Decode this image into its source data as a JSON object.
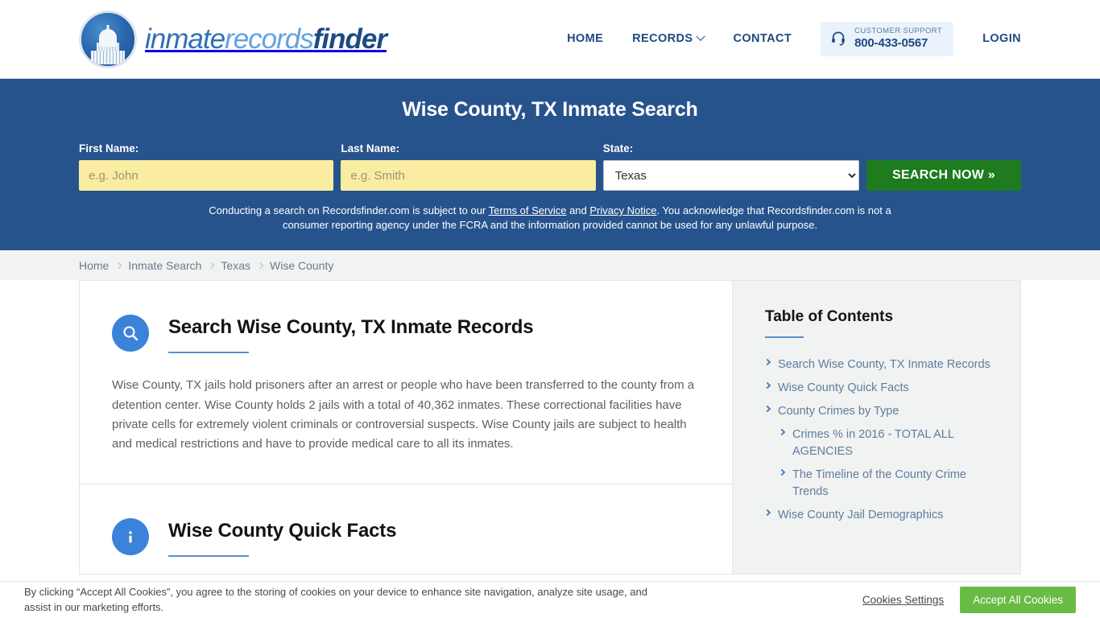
{
  "brand": {
    "wordmark_part1": "inmate",
    "wordmark_part2": "records",
    "wordmark_part3": "finder",
    "seal_icon": "capitol-dome-icon"
  },
  "nav": {
    "items": [
      {
        "label": "HOME",
        "has_caret": false
      },
      {
        "label": "RECORDS",
        "has_caret": true
      },
      {
        "label": "CONTACT",
        "has_caret": false
      }
    ],
    "login_label": "LOGIN",
    "support": {
      "icon": "headset-icon",
      "label": "CUSTOMER SUPPORT",
      "phone": "800-433-0567",
      "background": "#eaf2fb"
    }
  },
  "hero": {
    "background": "#27538d",
    "title": "Wise County, TX Inmate Search",
    "form": {
      "first_name_label": "First Name:",
      "first_name_value": "",
      "first_name_placeholder": "e.g. John",
      "last_name_label": "Last Name:",
      "last_name_value": "",
      "last_name_placeholder": "e.g. Smith",
      "state_label": "State:",
      "state_value": "Texas",
      "state_options": [
        "Texas"
      ],
      "search_button": "SEARCH NOW »",
      "search_button_color": "#1e7b1e",
      "input_background": "#faeda2"
    },
    "disclaimer": {
      "part1": "Conducting a search on Recordsfinder.com is subject to our ",
      "link1": "Terms of Service",
      "part2": " and ",
      "link2": "Privacy Notice",
      "part3": ". You acknowledge that Recordsfinder.com is not a consumer reporting agency under the FCRA and the information provided cannot be used for any unlawful purpose."
    }
  },
  "breadcrumb": {
    "items": [
      "Home",
      "Inmate Search",
      "Texas",
      "Wise County"
    ]
  },
  "main": {
    "sections": [
      {
        "icon": "search-circle-icon",
        "title": "Search Wise County, TX Inmate Records",
        "text": "Wise County, TX jails hold prisoners after an arrest or people who have been transferred to the county from a detention center. Wise County holds 2 jails with a total of 40,362 inmates. These correctional facilities have private cells for extremely violent criminals or controversial suspects. Wise County jails are subject to health and medical restrictions and have to provide medical care to all its inmates."
      },
      {
        "icon": "info-circle-icon",
        "title": "Wise County Quick Facts",
        "text": ""
      }
    ]
  },
  "sidebar": {
    "title": "Table of Contents",
    "items": [
      {
        "label": "Search Wise County, TX Inmate Records",
        "level": 1
      },
      {
        "label": "Wise County Quick Facts",
        "level": 1
      },
      {
        "label": "County Crimes by Type",
        "level": 1
      },
      {
        "label": "Crimes % in 2016 - TOTAL ALL AGENCIES",
        "level": 2
      },
      {
        "label": "The Timeline of the County Crime Trends",
        "level": 2
      },
      {
        "label": "Wise County Jail Demographics",
        "level": 1
      }
    ]
  },
  "cookie_bar": {
    "text": "By clicking “Accept All Cookies”, you agree to the storing of cookies on your device to enhance site navigation, analyze site usage, and assist in our marketing efforts.",
    "settings_label": "Cookies Settings",
    "accept_label": "Accept All Cookies",
    "accept_color": "#68bc45"
  }
}
